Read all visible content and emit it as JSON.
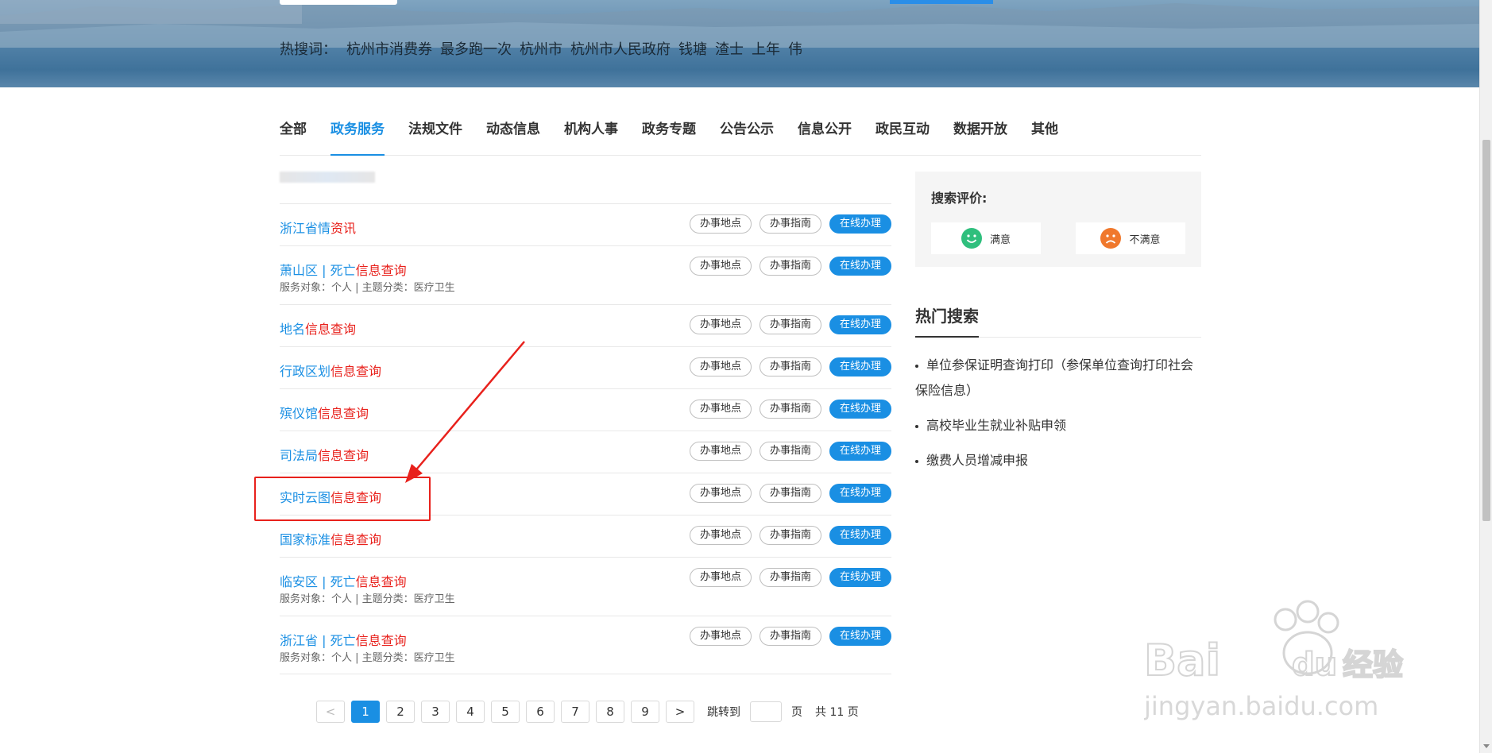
{
  "banner": {
    "hot_label": "热搜词：",
    "hot_words": [
      "杭州市消费券",
      "最多跑一次",
      "杭州市",
      "杭州市人民政府",
      "钱塘",
      "渣士",
      "上年",
      "伟"
    ]
  },
  "tabs": [
    {
      "label": "全部",
      "active": false
    },
    {
      "label": "政务服务",
      "active": true
    },
    {
      "label": "法规文件",
      "active": false
    },
    {
      "label": "动态信息",
      "active": false
    },
    {
      "label": "机构人事",
      "active": false
    },
    {
      "label": "政务专题",
      "active": false
    },
    {
      "label": "公告公示",
      "active": false
    },
    {
      "label": "信息公开",
      "active": false
    },
    {
      "label": "政民互动",
      "active": false
    },
    {
      "label": "数据开放",
      "active": false
    },
    {
      "label": "其他",
      "active": false
    }
  ],
  "buttons": {
    "location": "办事地点",
    "guide": "办事指南",
    "online": "在线办理"
  },
  "results": [
    {
      "prefix": "浙江省情",
      "highlight": "资讯",
      "meta": ""
    },
    {
      "prefix": "萧山区 | 死亡",
      "highlight": "信息查询",
      "meta": "服务对象：个人  |  主题分类：医疗卫生"
    },
    {
      "prefix": "地名",
      "highlight": "信息查询",
      "meta": ""
    },
    {
      "prefix": "行政区划",
      "highlight": "信息查询",
      "meta": ""
    },
    {
      "prefix": "殡仪馆",
      "highlight": "信息查询",
      "meta": ""
    },
    {
      "prefix": "司法局",
      "highlight": "信息查询",
      "meta": ""
    },
    {
      "prefix": "实时云图",
      "highlight": "信息查询",
      "meta": ""
    },
    {
      "prefix": "国家标准",
      "highlight": "信息查询",
      "meta": ""
    },
    {
      "prefix": "临安区 | 死亡",
      "highlight": "信息查询",
      "meta": "服务对象：个人  |  主题分类：医疗卫生"
    },
    {
      "prefix": "浙江省 | 死亡",
      "highlight": "信息查询",
      "meta": "服务对象：个人  |  主题分类：医疗卫生"
    }
  ],
  "pagination": {
    "prev": "<",
    "pages": [
      "1",
      "2",
      "3",
      "4",
      "5",
      "6",
      "7",
      "8",
      "9"
    ],
    "current": "1",
    "next": ">",
    "jump_label": "跳转到",
    "page_unit": "页",
    "total_text": "共 11 页"
  },
  "evaluation": {
    "title": "搜索评价:",
    "good": "满意",
    "bad": "不满意"
  },
  "hot_search": {
    "title": "热门搜索",
    "items": [
      "单位参保证明查询打印（参保单位查询打印社会保险信息）",
      "高校毕业生就业补贴申领",
      "缴费人员增减申报"
    ]
  },
  "watermark": {
    "brand": "Bai du 经验",
    "url": "jingyan.baidu.com"
  },
  "colors": {
    "accent": "#1a8fe3",
    "highlight": "#e8211c",
    "annotation": "#e8211c",
    "good": "#2fbf7d",
    "bad": "#f0782c"
  }
}
